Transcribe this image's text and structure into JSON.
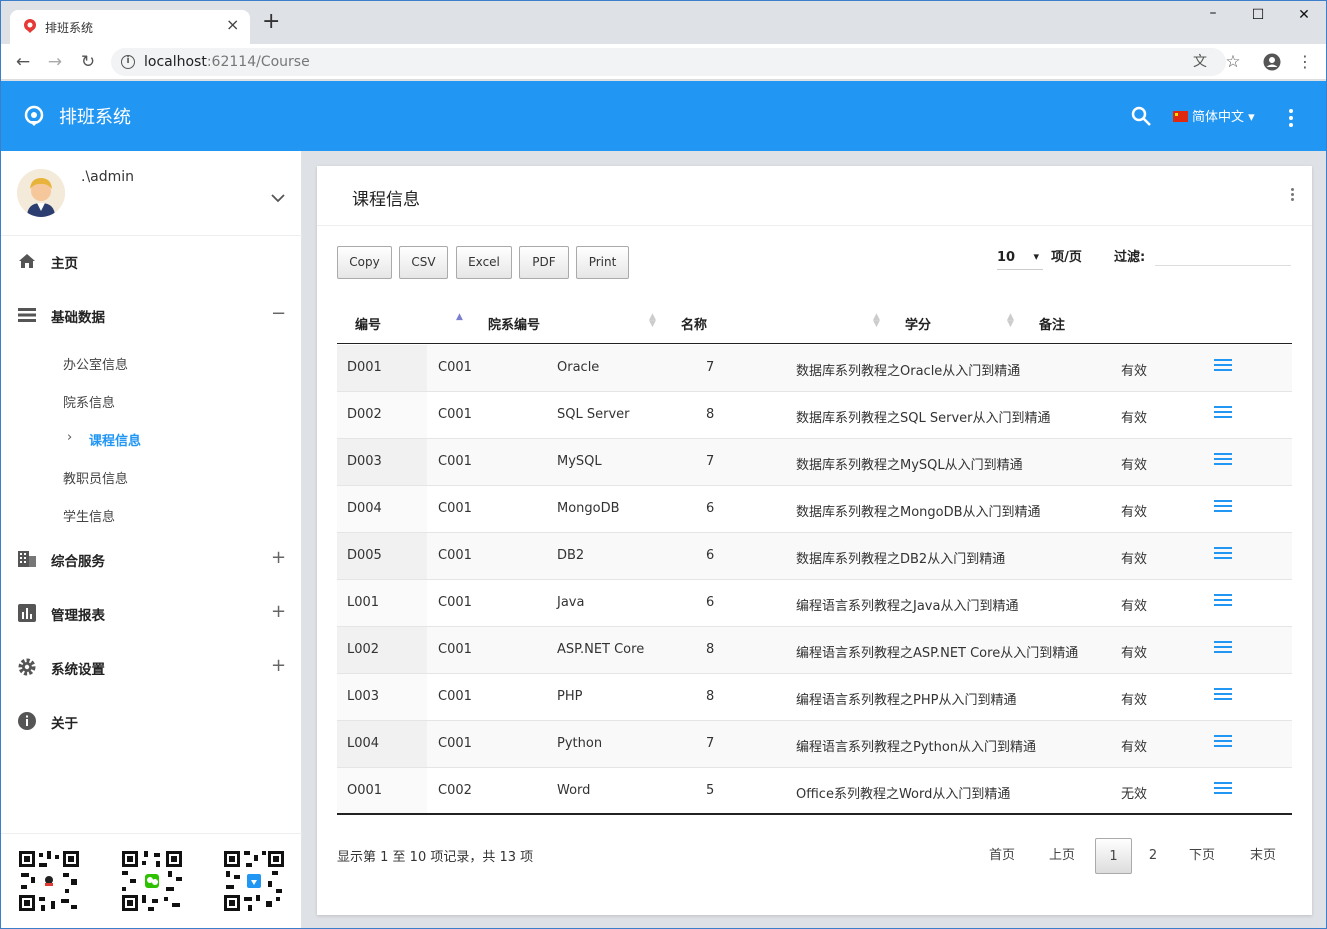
{
  "browser": {
    "tab_title": "排班系统",
    "url_host": "localhost",
    "url_rest": ":62114/Course"
  },
  "app": {
    "title": "排班系统",
    "language": "简体中文"
  },
  "user": {
    "name": ".\\admin"
  },
  "sidebar": {
    "items": [
      {
        "label": "主页"
      },
      {
        "label": "基础数据"
      },
      {
        "label": "综合服务"
      },
      {
        "label": "管理报表"
      },
      {
        "label": "系统设置"
      },
      {
        "label": "关于"
      }
    ],
    "sub_items": [
      "办公室信息",
      "院系信息",
      "课程信息",
      "教职员信息",
      "学生信息"
    ],
    "active_sub": "课程信息"
  },
  "card": {
    "title": "课程信息",
    "buttons": [
      "Copy",
      "CSV",
      "Excel",
      "PDF",
      "Print"
    ],
    "page_length": "10",
    "per_page_label": "项/页",
    "filter_label": "过滤:"
  },
  "table": {
    "headers": [
      "编号",
      "院系编号",
      "名称",
      "学分",
      "备注"
    ],
    "rows": [
      [
        "D001",
        "C001",
        "Oracle",
        "7",
        "数据库系列教程之Oracle从入门到精通",
        "有效"
      ],
      [
        "D002",
        "C001",
        "SQL Server",
        "8",
        "数据库系列教程之SQL Server从入门到精通",
        "有效"
      ],
      [
        "D003",
        "C001",
        "MySQL",
        "7",
        "数据库系列教程之MySQL从入门到精通",
        "有效"
      ],
      [
        "D004",
        "C001",
        "MongoDB",
        "6",
        "数据库系列教程之MongoDB从入门到精通",
        "有效"
      ],
      [
        "D005",
        "C001",
        "DB2",
        "6",
        "数据库系列教程之DB2从入门到精通",
        "有效"
      ],
      [
        "L001",
        "C001",
        "Java",
        "6",
        "编程语言系列教程之Java从入门到精通",
        "有效"
      ],
      [
        "L002",
        "C001",
        "ASP.NET Core",
        "8",
        "编程语言系列教程之ASP.NET Core从入门到精通",
        "有效"
      ],
      [
        "L003",
        "C001",
        "PHP",
        "8",
        "编程语言系列教程之PHP从入门到精通",
        "有效"
      ],
      [
        "L004",
        "C001",
        "Python",
        "7",
        "编程语言系列教程之Python从入门到精通",
        "有效"
      ],
      [
        "O001",
        "C002",
        "Word",
        "5",
        "Office系列教程之Word从入门到精通",
        "无效"
      ]
    ]
  },
  "pagination": {
    "info": "显示第 1 至 10 项记录，共 13 项",
    "first": "首页",
    "prev": "上页",
    "pages": [
      "1",
      "2"
    ],
    "current": "1",
    "next": "下页",
    "last": "末页"
  }
}
